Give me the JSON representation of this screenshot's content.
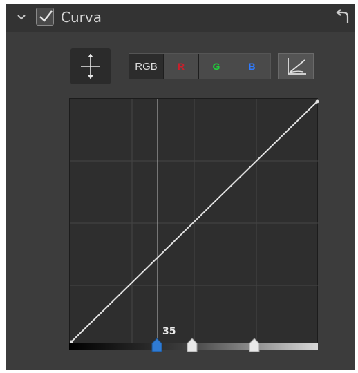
{
  "panel": {
    "title": "Curva",
    "enabled": true
  },
  "icons": {
    "collapse": "chevron-down-icon",
    "checkbox": "checkmark-icon",
    "undo": "undo-arrow-icon",
    "move_point_tool": "move-point-icon",
    "linear_curve": "linear-curve-icon"
  },
  "channels": {
    "rgb": "RGB",
    "red": "R",
    "green": "G",
    "blue": "B",
    "selected": "RGB",
    "colors": {
      "red": "#c8202c",
      "green": "#1fcf3a",
      "blue": "#2f7bff"
    }
  },
  "curve": {
    "input_value": "35",
    "points": [
      [
        0,
        0
      ],
      [
        255,
        255
      ]
    ],
    "grid_divisions": 4
  },
  "range_handles": {
    "colors": {
      "active": "#2f7bd4",
      "inactive": "#e8e8e8"
    }
  },
  "accent_color": "#2f7bd4"
}
